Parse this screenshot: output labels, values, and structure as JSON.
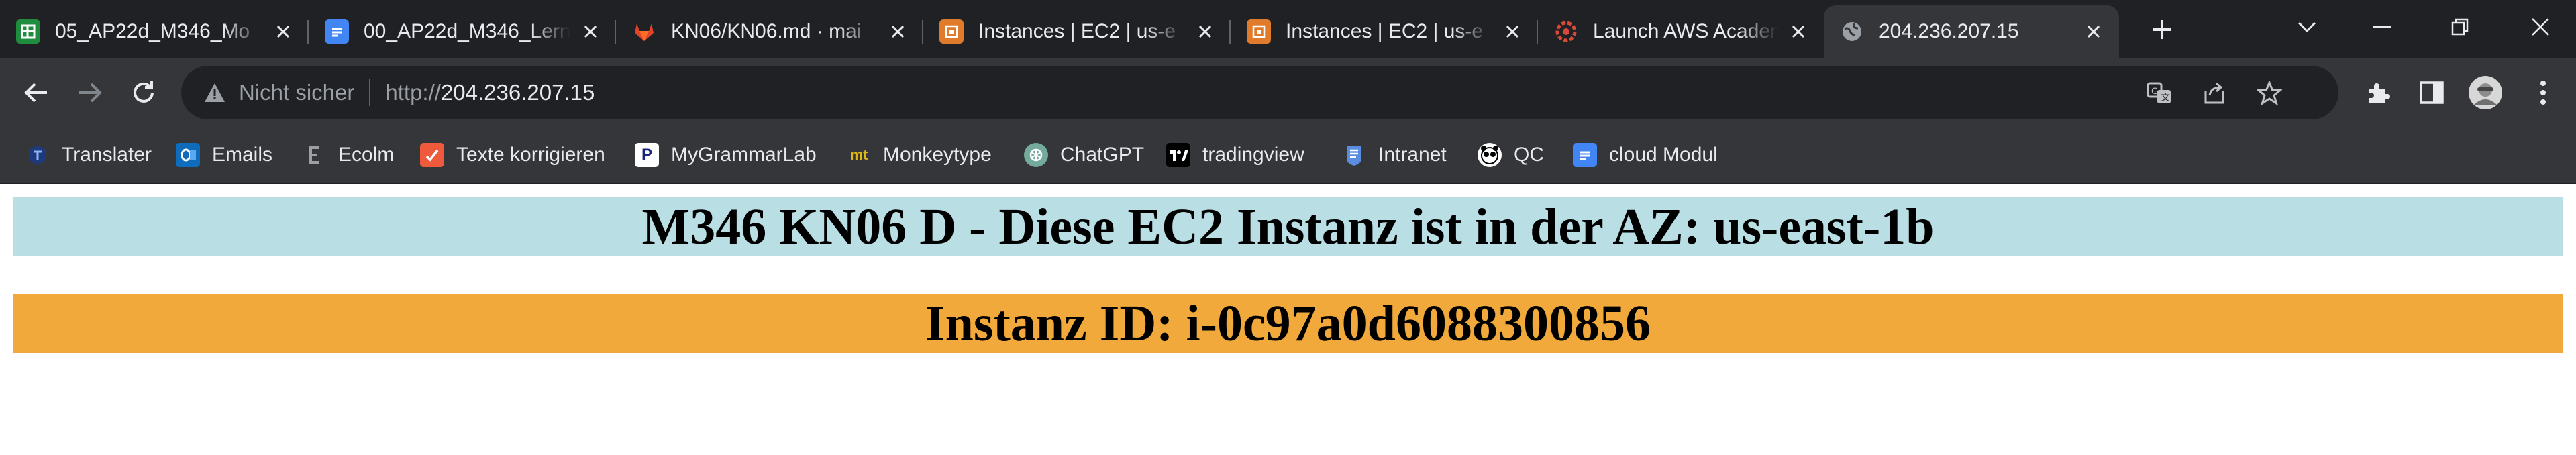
{
  "colors": {
    "az_banner": "#b9dee4",
    "id_banner": "#f2a93b",
    "tab_strip": "#202124",
    "toolbar": "#35363a"
  },
  "tabs": [
    {
      "title": "05_AP22d_M346_Mo",
      "icon": "google-sheets-icon",
      "active": false
    },
    {
      "title": "00_AP22d_M346_Lern",
      "icon": "google-docs-icon",
      "active": false
    },
    {
      "title": "KN06/KN06.md · mai",
      "icon": "gitlab-icon",
      "active": false
    },
    {
      "title": "Instances | EC2 | us-e",
      "icon": "aws-ec2-icon",
      "active": false
    },
    {
      "title": "Instances | EC2 | us-e",
      "icon": "aws-ec2-icon",
      "active": false
    },
    {
      "title": "Launch AWS Academ",
      "icon": "aws-academy-icon",
      "active": false
    },
    {
      "title": "204.236.207.15",
      "icon": "globe-icon",
      "active": true
    }
  ],
  "address": {
    "security_label": "Nicht sicher",
    "scheme": "http://",
    "host": "204.236.207.15"
  },
  "bookmarks": [
    {
      "label": "Translater",
      "icon": "translate-icon"
    },
    {
      "label": "Emails",
      "icon": "outlook-icon"
    },
    {
      "label": "Ecolm",
      "icon": "ecolm-icon"
    },
    {
      "label": "Texte korrigieren",
      "icon": "text-correct-icon"
    },
    {
      "label": "MyGrammarLab",
      "icon": "mygrammarlab-icon"
    },
    {
      "label": "Monkeytype",
      "icon": "monkeytype-icon"
    },
    {
      "label": "ChatGPT",
      "icon": "chatgpt-icon"
    },
    {
      "label": "tradingview",
      "icon": "tradingview-icon"
    },
    {
      "label": "Intranet",
      "icon": "intranet-icon"
    },
    {
      "label": "QC",
      "icon": "qc-icon"
    },
    {
      "label": "cloud Modul",
      "icon": "google-docs-icon"
    }
  ],
  "bookmark_glyphs": {
    "mygrammarlab": "P",
    "monkeytype": "mt"
  },
  "page": {
    "az_heading": "M346 KN06 D - Diese EC2 Instanz ist in der AZ: us-east-1b",
    "id_heading": "Instanz ID: i-0c97a0d6088300856"
  }
}
